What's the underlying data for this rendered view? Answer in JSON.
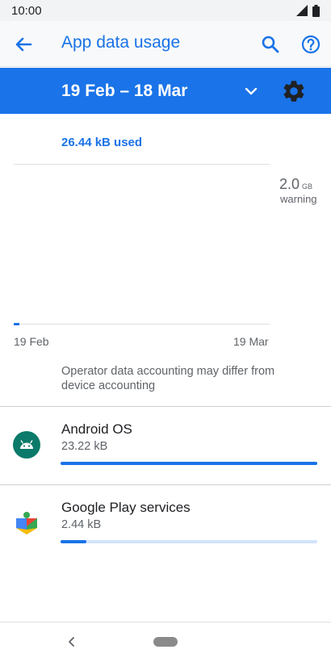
{
  "status_bar": {
    "time": "10:00",
    "icons": [
      "signal-icon",
      "battery-icon"
    ]
  },
  "header": {
    "title": "App data usage",
    "icons": [
      "back-arrow-icon",
      "search-icon",
      "help-icon"
    ],
    "accent_color": "#1a73e8"
  },
  "period": {
    "label": "19 Feb – 18 Mar",
    "icons": [
      "chevron-down-icon",
      "gear-icon"
    ],
    "background": "#1a73e8"
  },
  "chart": {
    "used_label": "26.44 kB used",
    "warning_value": "2.0",
    "warning_unit": "GB",
    "warning_label": "warning",
    "x_start": "19 Feb",
    "x_end": "19 Mar"
  },
  "note": "Operator data accounting may differ from device accounting",
  "apps": [
    {
      "name": "Android OS",
      "size": "23.22 kB",
      "usage_fraction": 1.0,
      "icon": "android-icon"
    },
    {
      "name": "Google Play services",
      "size": "2.44 kB",
      "usage_fraction": 0.1,
      "icon": "puzzle-piece-icon"
    }
  ],
  "nav": {
    "icons": [
      "back-chevron-icon",
      "home-pill"
    ]
  }
}
